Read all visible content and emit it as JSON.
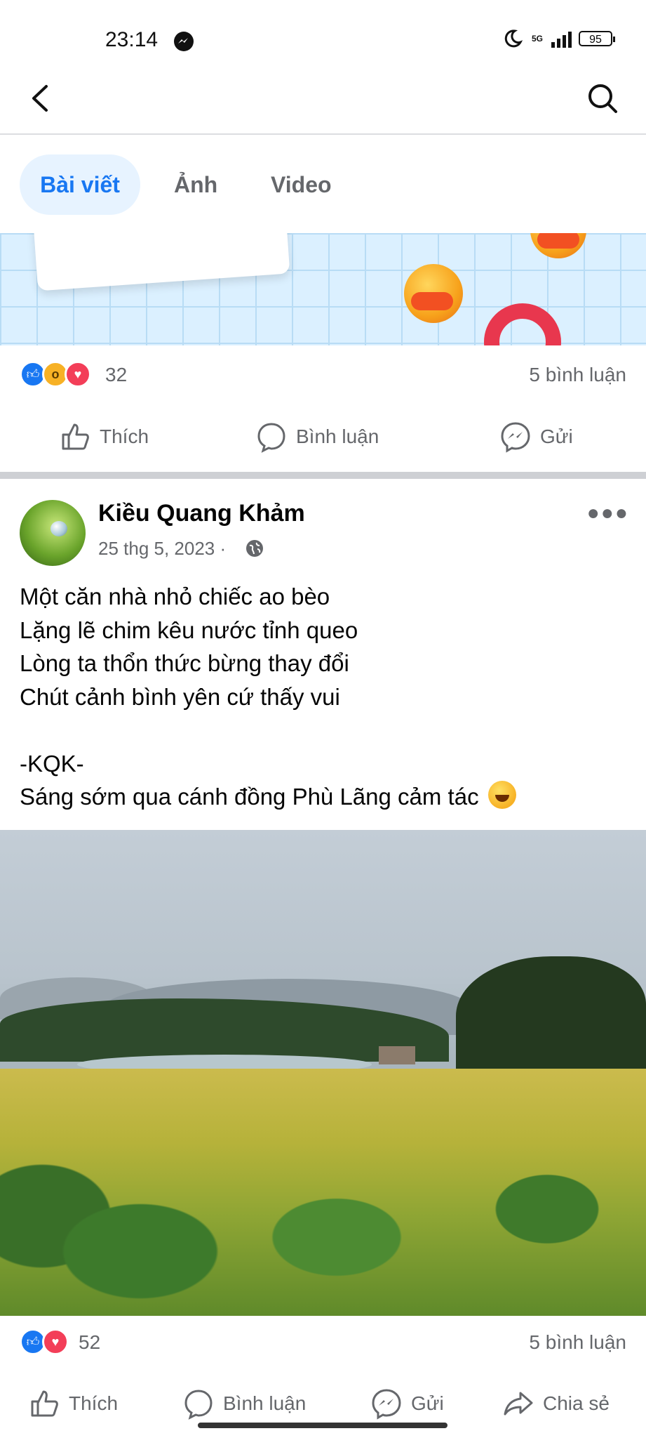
{
  "status_bar": {
    "time": "23:14",
    "network": "5G",
    "battery": "95"
  },
  "tabs": [
    {
      "label": "Bài viết",
      "active": true
    },
    {
      "label": "Ảnh",
      "active": false
    },
    {
      "label": "Video",
      "active": false
    }
  ],
  "previous_post": {
    "reaction_count": "32",
    "comments": "5 bình luận",
    "actions": {
      "like": "Thích",
      "comment": "Bình luận",
      "send": "Gửi"
    }
  },
  "post": {
    "author": "Kiều Quang Khảm",
    "date": "25 thg 5, 2023 ·",
    "text_lines": [
      "Một căn nhà nhỏ chiếc ao bèo",
      "Lặng lẽ chim kêu nước tỉnh queo",
      "Lòng ta thổn thức bừng thay đổi",
      "Chút cảnh bình yên cứ thấy vui",
      "",
      "-KQK-",
      "Sáng sớm qua cánh đồng Phù Lãng cảm tác"
    ],
    "reaction_count": "52",
    "comments": "5 bình luận",
    "actions": {
      "like": "Thích",
      "comment": "Bình luận",
      "send": "Gửi",
      "share": "Chia sẻ"
    }
  },
  "colors": {
    "accent": "#1877f2",
    "tab_active_bg": "#e7f3ff",
    "secondary_text": "#65676b",
    "separator": "#ced0d4"
  },
  "icons": [
    "messenger-icon",
    "moon-icon",
    "signal-icon",
    "battery-icon",
    "back-arrow-icon",
    "search-icon",
    "like-reaction-icon",
    "wow-reaction-icon",
    "love-reaction-icon",
    "thumbs-up-icon",
    "comment-icon",
    "messenger-send-icon",
    "share-icon",
    "globe-icon",
    "more-options-icon",
    "laughing-emoji-icon"
  ]
}
